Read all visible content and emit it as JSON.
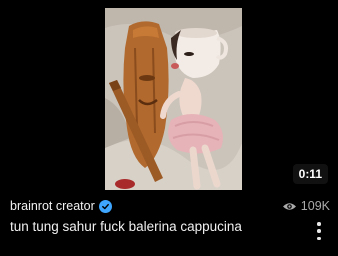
{
  "video": {
    "duration": "0:11",
    "creator": "brainrot creator",
    "views": "109K",
    "title": "tun tung sahur fuck balerina cappucina"
  },
  "icons": {
    "verified": "verified-check-icon",
    "views": "eye-icon",
    "more": "more-vertical-icon"
  },
  "colors": {
    "background": "#000000",
    "verified": "#3ea6ff",
    "muted_text": "#aaaaaa"
  }
}
